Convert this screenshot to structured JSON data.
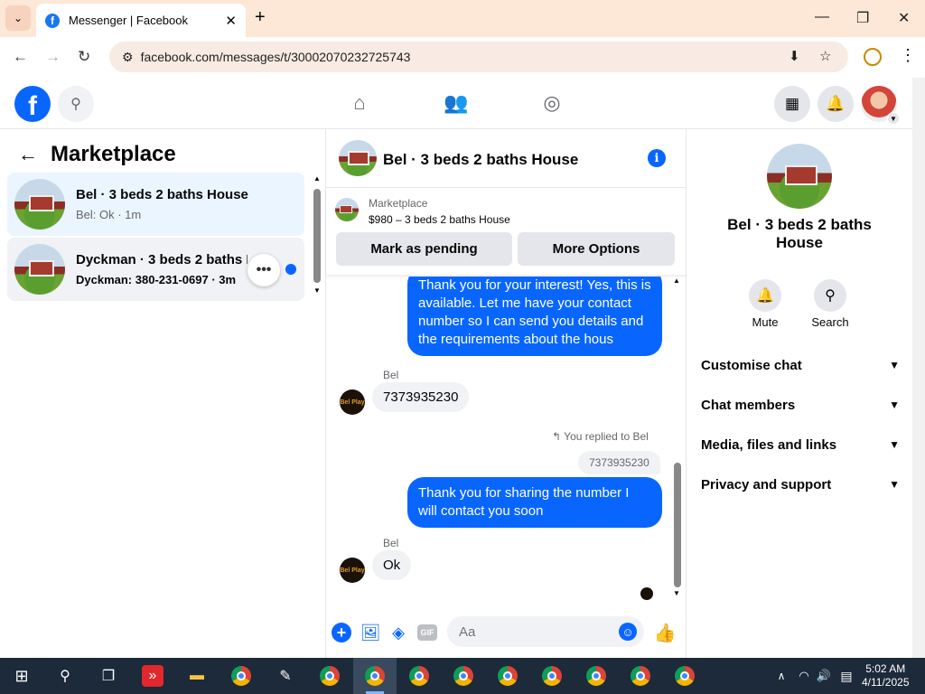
{
  "browser": {
    "tab_title": "Messenger | Facebook",
    "url": "facebook.com/messages/t/30002070232725743"
  },
  "left_panel": {
    "title": "Marketplace",
    "conversations": [
      {
        "name": "Bel · 3 beds 2 baths House",
        "preview": "Bel: Ok · 1m"
      },
      {
        "name": "Dyckman · 3 beds 2 baths House",
        "preview": "Dyckman: 380-231-0697 · 3m"
      }
    ]
  },
  "chat": {
    "title": "Bel · 3 beds 2 baths House",
    "listing_source": "Marketplace",
    "listing_price": "$980 – 3 beds 2 baths House",
    "mark_pending_label": "Mark as pending",
    "more_options_label": "More Options",
    "messages": {
      "out_1": "Thank you for your interest! Yes, this is available. Let me have your contact number so I can send you details and the requirements about the hous",
      "sender_1": "Bel",
      "in_1": "7373935230",
      "replied_note": "You replied to Bel",
      "quoted": "7373935230",
      "out_2": "Thank you for sharing the number I will contact you soon",
      "sender_2": "Bel",
      "in_2": "Ok"
    },
    "avatar_text": "Bel Play",
    "composer_placeholder": "Aa"
  },
  "right_panel": {
    "title": "Bel · 3 beds 2 baths House",
    "mute_label": "Mute",
    "search_label": "Search",
    "sections": [
      "Customise chat",
      "Chat members",
      "Media, files and links",
      "Privacy and support"
    ]
  },
  "taskbar": {
    "time": "5:02 AM",
    "date": "4/11/2025"
  },
  "colors": {
    "accent": "#0866ff",
    "active_conversation": "#ebf5ff",
    "tabstrip": "#fde7d6"
  }
}
